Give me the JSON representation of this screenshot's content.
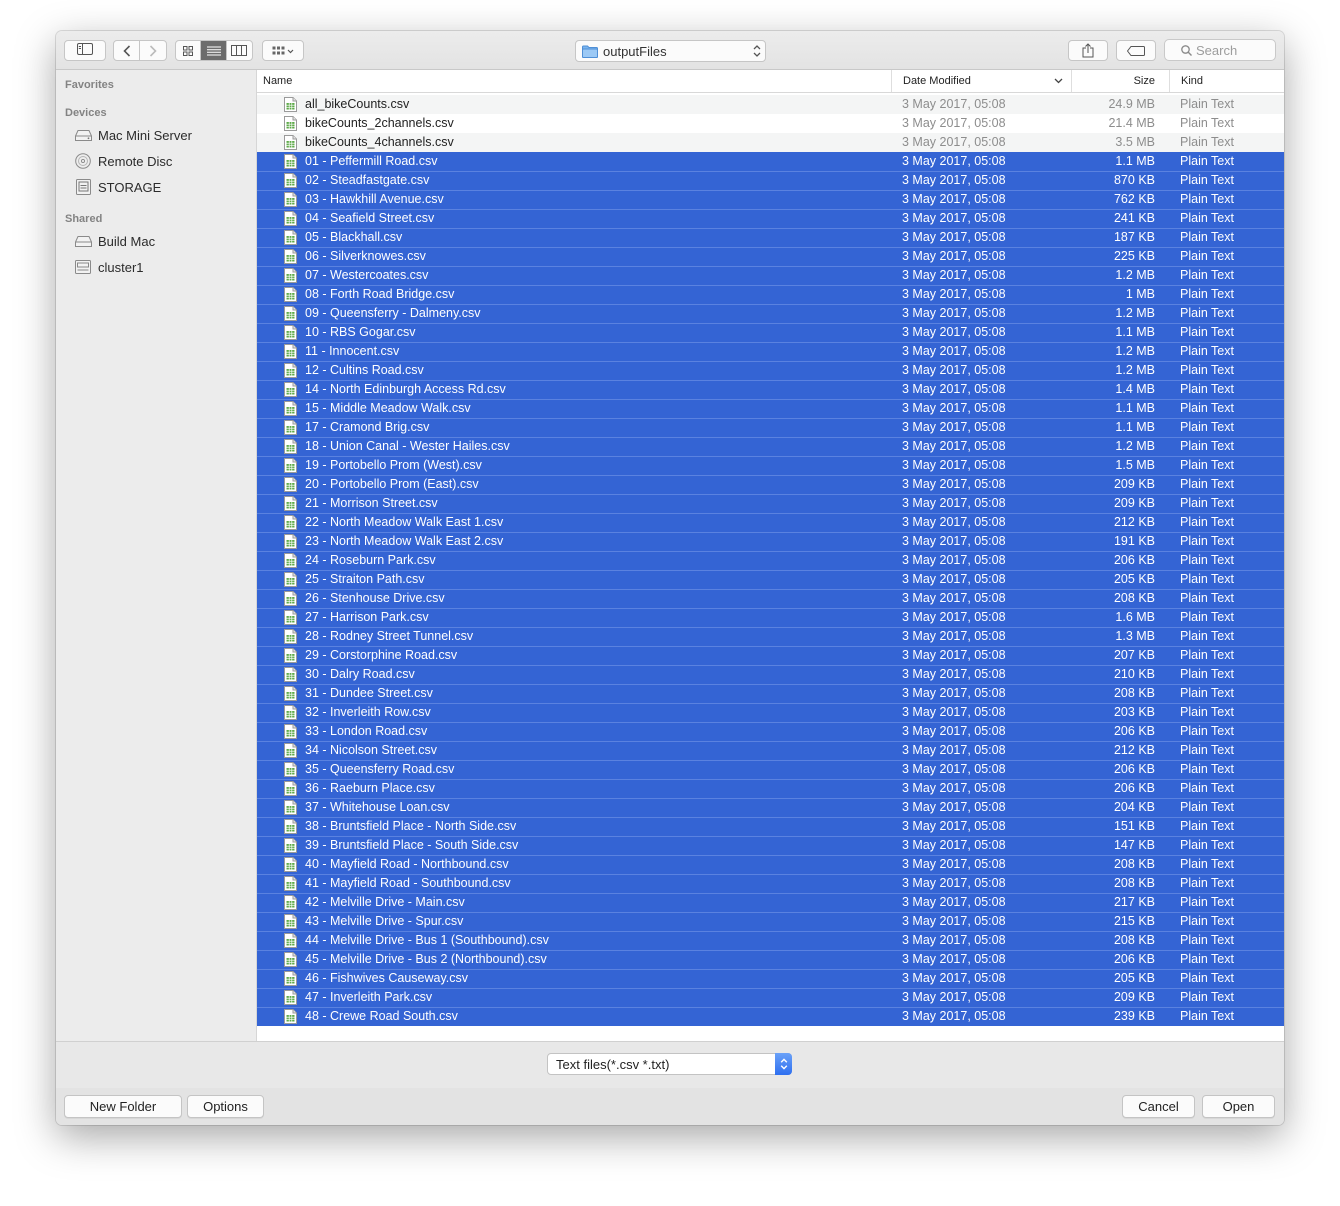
{
  "toolbar": {
    "location": "outputFiles",
    "search_placeholder": "Search"
  },
  "sidebar": {
    "favorites_heading": "Favorites",
    "devices_heading": "Devices",
    "devices": [
      {
        "label": "Mac Mini Server",
        "icon": "hard-drive-icon"
      },
      {
        "label": "Remote Disc",
        "icon": "disc-icon"
      },
      {
        "label": "STORAGE",
        "icon": "external-drive-icon"
      }
    ],
    "shared_heading": "Shared",
    "shared": [
      {
        "label": "Build Mac",
        "icon": "server-icon"
      },
      {
        "label": "cluster1",
        "icon": "network-computer-icon"
      }
    ]
  },
  "columns": {
    "name": "Name",
    "date": "Date Modified",
    "size": "Size",
    "kind": "Kind"
  },
  "files": [
    {
      "name": "all_bikeCounts.csv",
      "date": "3 May 2017, 05:08",
      "size": "24.9 MB",
      "kind": "Plain Text",
      "selected": false
    },
    {
      "name": "bikeCounts_2channels.csv",
      "date": "3 May 2017, 05:08",
      "size": "21.4 MB",
      "kind": "Plain Text",
      "selected": false
    },
    {
      "name": "bikeCounts_4channels.csv",
      "date": "3 May 2017, 05:08",
      "size": "3.5 MB",
      "kind": "Plain Text",
      "selected": false
    },
    {
      "name": "01 - Peffermill Road.csv",
      "date": "3 May 2017, 05:08",
      "size": "1.1 MB",
      "kind": "Plain Text",
      "selected": true
    },
    {
      "name": "02 - Steadfastgate.csv",
      "date": "3 May 2017, 05:08",
      "size": "870 KB",
      "kind": "Plain Text",
      "selected": true
    },
    {
      "name": "03 - Hawkhill Avenue.csv",
      "date": "3 May 2017, 05:08",
      "size": "762 KB",
      "kind": "Plain Text",
      "selected": true
    },
    {
      "name": "04 - Seafield Street.csv",
      "date": "3 May 2017, 05:08",
      "size": "241 KB",
      "kind": "Plain Text",
      "selected": true
    },
    {
      "name": "05 - Blackhall.csv",
      "date": "3 May 2017, 05:08",
      "size": "187 KB",
      "kind": "Plain Text",
      "selected": true
    },
    {
      "name": "06 - Silverknowes.csv",
      "date": "3 May 2017, 05:08",
      "size": "225 KB",
      "kind": "Plain Text",
      "selected": true
    },
    {
      "name": "07 - Westercoates.csv",
      "date": "3 May 2017, 05:08",
      "size": "1.2 MB",
      "kind": "Plain Text",
      "selected": true
    },
    {
      "name": "08 - Forth Road Bridge.csv",
      "date": "3 May 2017, 05:08",
      "size": "1 MB",
      "kind": "Plain Text",
      "selected": true
    },
    {
      "name": "09 - Queensferry - Dalmeny.csv",
      "date": "3 May 2017, 05:08",
      "size": "1.2 MB",
      "kind": "Plain Text",
      "selected": true
    },
    {
      "name": "10 - RBS Gogar.csv",
      "date": "3 May 2017, 05:08",
      "size": "1.1 MB",
      "kind": "Plain Text",
      "selected": true
    },
    {
      "name": "11 - Innocent.csv",
      "date": "3 May 2017, 05:08",
      "size": "1.2 MB",
      "kind": "Plain Text",
      "selected": true
    },
    {
      "name": "12 - Cultins Road.csv",
      "date": "3 May 2017, 05:08",
      "size": "1.2 MB",
      "kind": "Plain Text",
      "selected": true
    },
    {
      "name": "14 - North Edinburgh Access Rd.csv",
      "date": "3 May 2017, 05:08",
      "size": "1.4 MB",
      "kind": "Plain Text",
      "selected": true
    },
    {
      "name": "15 - Middle Meadow Walk.csv",
      "date": "3 May 2017, 05:08",
      "size": "1.1 MB",
      "kind": "Plain Text",
      "selected": true
    },
    {
      "name": "17 - Cramond Brig.csv",
      "date": "3 May 2017, 05:08",
      "size": "1.1 MB",
      "kind": "Plain Text",
      "selected": true
    },
    {
      "name": "18 - Union Canal - Wester Hailes.csv",
      "date": "3 May 2017, 05:08",
      "size": "1.2 MB",
      "kind": "Plain Text",
      "selected": true
    },
    {
      "name": "19 - Portobello Prom (West).csv",
      "date": "3 May 2017, 05:08",
      "size": "1.5 MB",
      "kind": "Plain Text",
      "selected": true
    },
    {
      "name": "20 - Portobello Prom (East).csv",
      "date": "3 May 2017, 05:08",
      "size": "209 KB",
      "kind": "Plain Text",
      "selected": true
    },
    {
      "name": "21 - Morrison Street.csv",
      "date": "3 May 2017, 05:08",
      "size": "209 KB",
      "kind": "Plain Text",
      "selected": true
    },
    {
      "name": "22 - North Meadow Walk East 1.csv",
      "date": "3 May 2017, 05:08",
      "size": "212 KB",
      "kind": "Plain Text",
      "selected": true
    },
    {
      "name": "23 - North Meadow Walk East 2.csv",
      "date": "3 May 2017, 05:08",
      "size": "191 KB",
      "kind": "Plain Text",
      "selected": true
    },
    {
      "name": "24 - Roseburn Park.csv",
      "date": "3 May 2017, 05:08",
      "size": "206 KB",
      "kind": "Plain Text",
      "selected": true
    },
    {
      "name": "25 - Straiton Path.csv",
      "date": "3 May 2017, 05:08",
      "size": "205 KB",
      "kind": "Plain Text",
      "selected": true
    },
    {
      "name": "26 - Stenhouse Drive.csv",
      "date": "3 May 2017, 05:08",
      "size": "208 KB",
      "kind": "Plain Text",
      "selected": true
    },
    {
      "name": "27 - Harrison Park.csv",
      "date": "3 May 2017, 05:08",
      "size": "1.6 MB",
      "kind": "Plain Text",
      "selected": true
    },
    {
      "name": "28 - Rodney Street Tunnel.csv",
      "date": "3 May 2017, 05:08",
      "size": "1.3 MB",
      "kind": "Plain Text",
      "selected": true
    },
    {
      "name": "29 - Corstorphine Road.csv",
      "date": "3 May 2017, 05:08",
      "size": "207 KB",
      "kind": "Plain Text",
      "selected": true
    },
    {
      "name": "30 - Dalry Road.csv",
      "date": "3 May 2017, 05:08",
      "size": "210 KB",
      "kind": "Plain Text",
      "selected": true
    },
    {
      "name": "31 - Dundee Street.csv",
      "date": "3 May 2017, 05:08",
      "size": "208 KB",
      "kind": "Plain Text",
      "selected": true
    },
    {
      "name": "32 - Inverleith Row.csv",
      "date": "3 May 2017, 05:08",
      "size": "203 KB",
      "kind": "Plain Text",
      "selected": true
    },
    {
      "name": "33 - London Road.csv",
      "date": "3 May 2017, 05:08",
      "size": "206 KB",
      "kind": "Plain Text",
      "selected": true
    },
    {
      "name": "34 - Nicolson Street.csv",
      "date": "3 May 2017, 05:08",
      "size": "212 KB",
      "kind": "Plain Text",
      "selected": true
    },
    {
      "name": "35 - Queensferry Road.csv",
      "date": "3 May 2017, 05:08",
      "size": "206 KB",
      "kind": "Plain Text",
      "selected": true
    },
    {
      "name": "36 - Raeburn Place.csv",
      "date": "3 May 2017, 05:08",
      "size": "206 KB",
      "kind": "Plain Text",
      "selected": true
    },
    {
      "name": "37 - Whitehouse Loan.csv",
      "date": "3 May 2017, 05:08",
      "size": "204 KB",
      "kind": "Plain Text",
      "selected": true
    },
    {
      "name": "38 - Bruntsfield Place - North Side.csv",
      "date": "3 May 2017, 05:08",
      "size": "151 KB",
      "kind": "Plain Text",
      "selected": true
    },
    {
      "name": "39 - Bruntsfield Place - South Side.csv",
      "date": "3 May 2017, 05:08",
      "size": "147 KB",
      "kind": "Plain Text",
      "selected": true
    },
    {
      "name": "40 - Mayfield Road - Northbound.csv",
      "date": "3 May 2017, 05:08",
      "size": "208 KB",
      "kind": "Plain Text",
      "selected": true
    },
    {
      "name": "41 - Mayfield Road - Southbound.csv",
      "date": "3 May 2017, 05:08",
      "size": "208 KB",
      "kind": "Plain Text",
      "selected": true
    },
    {
      "name": "42 - Melville Drive - Main.csv",
      "date": "3 May 2017, 05:08",
      "size": "217 KB",
      "kind": "Plain Text",
      "selected": true
    },
    {
      "name": "43 - Melville Drive - Spur.csv",
      "date": "3 May 2017, 05:08",
      "size": "215 KB",
      "kind": "Plain Text",
      "selected": true
    },
    {
      "name": "44 - Melville Drive - Bus 1 (Southbound).csv",
      "date": "3 May 2017, 05:08",
      "size": "208 KB",
      "kind": "Plain Text",
      "selected": true
    },
    {
      "name": "45 - Melville Drive - Bus 2 (Northbound).csv",
      "date": "3 May 2017, 05:08",
      "size": "206 KB",
      "kind": "Plain Text",
      "selected": true
    },
    {
      "name": "46 - Fishwives Causeway.csv",
      "date": "3 May 2017, 05:08",
      "size": "205 KB",
      "kind": "Plain Text",
      "selected": true
    },
    {
      "name": "47 - Inverleith Park.csv",
      "date": "3 May 2017, 05:08",
      "size": "209 KB",
      "kind": "Plain Text",
      "selected": true
    },
    {
      "name": "48 - Crewe Road South.csv",
      "date": "3 May 2017, 05:08",
      "size": "239 KB",
      "kind": "Plain Text",
      "selected": true
    }
  ],
  "filter": {
    "selected": "Text files(*.csv *.txt)"
  },
  "buttons": {
    "new_folder": "New Folder",
    "options": "Options",
    "cancel": "Cancel",
    "open": "Open"
  },
  "colors": {
    "selection": "#3464d4",
    "accent": "#2e6ff0",
    "file_icon": "#5daa48"
  }
}
